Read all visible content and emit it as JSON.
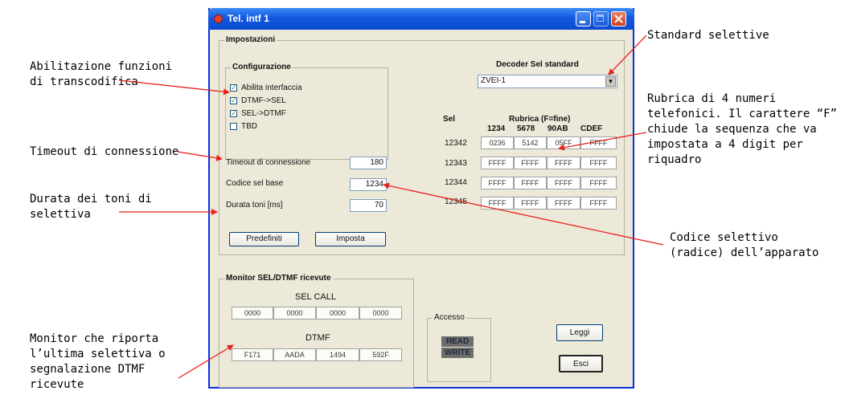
{
  "window": {
    "title": "Tel. intf 1",
    "impostazioni": {
      "label": "Impostazioni",
      "configurazione": {
        "label": "Configurazione",
        "options": [
          {
            "label": "Abilita interfaccia",
            "checked": true
          },
          {
            "label": "DTMF->SEL",
            "checked": true
          },
          {
            "label": "SEL->DTMF",
            "checked": true
          },
          {
            "label": "TBD",
            "checked": false
          }
        ]
      },
      "decoder_label": "Decoder Sel standard",
      "decoder_value": "ZVEI-1",
      "timeout": {
        "label": "Timeout di connessione",
        "value": "180"
      },
      "codice": {
        "label": "Codice sel base",
        "value": "1234"
      },
      "durata": {
        "label": "Durata toni [ms]",
        "value": "70"
      },
      "predefiniti_label": "Predefiniti",
      "imposta_label": "Imposta",
      "rubrica": {
        "sel_header": "Sel",
        "title": "Rubrica (F=fine)",
        "columns": [
          "1234",
          "5678",
          "90AB",
          "CDEF"
        ],
        "rows": [
          {
            "sel": "12342",
            "values": [
              "0236",
              "5142",
              "05FF",
              "FFFF"
            ]
          },
          {
            "sel": "12343",
            "values": [
              "FFFF",
              "FFFF",
              "FFFF",
              "FFFF"
            ]
          },
          {
            "sel": "12344",
            "values": [
              "FFFF",
              "FFFF",
              "FFFF",
              "FFFF"
            ]
          },
          {
            "sel": "12345",
            "values": [
              "FFFF",
              "FFFF",
              "FFFF",
              "FFFF"
            ]
          }
        ]
      }
    },
    "monitor": {
      "label": "Monitor SEL/DTMF ricevute",
      "sel_call_label": "SEL CALL",
      "sel_call_values": [
        "0000",
        "0000",
        "0000",
        "0000"
      ],
      "dtmf_label": "DTMF",
      "dtmf_values": [
        "F171",
        "AADA",
        "1494",
        "592F"
      ]
    },
    "accesso": {
      "label": "Accesso",
      "read": "READ",
      "write": "WRITE"
    },
    "leggi_label": "Leggi",
    "esci_label": "Esci"
  },
  "annotations": {
    "standard": "Standard selettive",
    "abilitazione": "Abilitazione funzioni\ndi transcodifica",
    "rubrica": "Rubrica di 4 numeri\ntelefonici. Il carattere “F”\nchiude la sequenza che va\nimpostata a 4 digit per\nriquadro",
    "timeout": "Timeout di connessione",
    "durata": "Durata dei toni di\nselettiva",
    "codice": "Codice selettivo\n(radice) dell’apparato",
    "monitor": "Monitor che riporta\nl’ultima selettiva o\nsegnalazione DTMF\nricevute"
  },
  "colors": {
    "arrow": "#e8201c",
    "titlebar": "#1258e0",
    "window_bg": "#ece9d8"
  }
}
